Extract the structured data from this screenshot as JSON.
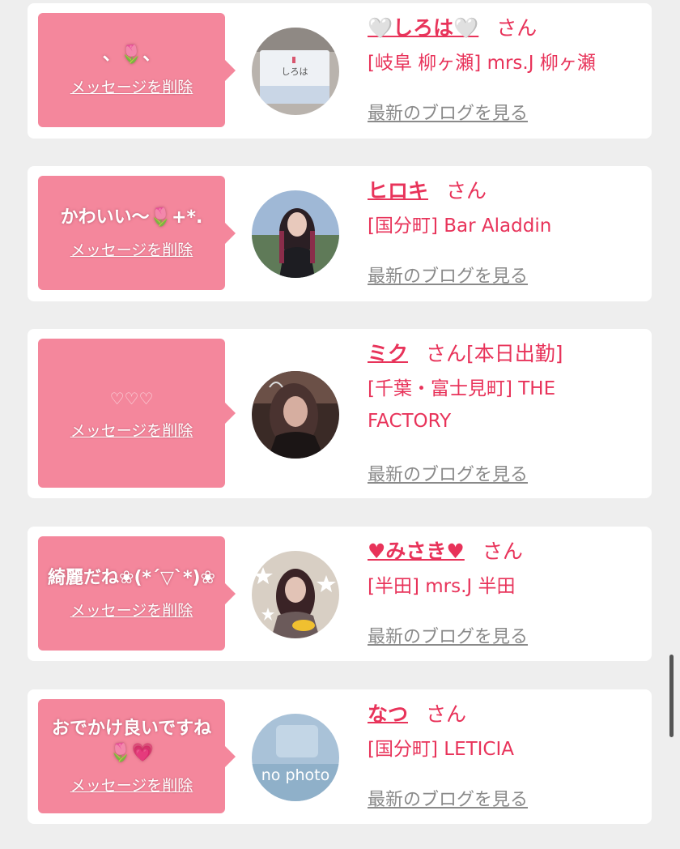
{
  "delete_label": "メッセージを削除",
  "blog_label": "最新のブログを見る",
  "san_label": "さん",
  "cards": [
    {
      "message": "、🌷、",
      "name": "🤍しろは🤍",
      "status": "",
      "shop": "[岐阜 柳ヶ瀬] mrs.J 柳ヶ瀬",
      "avatar_text": "しろは"
    },
    {
      "message": "かわいい〜🌷+*.",
      "name": "ヒロキ",
      "status": "",
      "shop": "[国分町] Bar Aladdin"
    },
    {
      "message": "♡♡♡",
      "name": "ミク",
      "status": "[本日出勤]",
      "shop": "[千葉・富士見町] THE FACTORY"
    },
    {
      "message": "綺麗だね❀(*´▽`*)❀",
      "name": "♥みさき♥",
      "status": "",
      "shop": "[半田] mrs.J 半田"
    },
    {
      "message": "おでかけ良いですね🌷💗",
      "name": "なつ",
      "status": "",
      "shop": "[国分町] LETICIA",
      "avatar_text": "no photo"
    }
  ]
}
